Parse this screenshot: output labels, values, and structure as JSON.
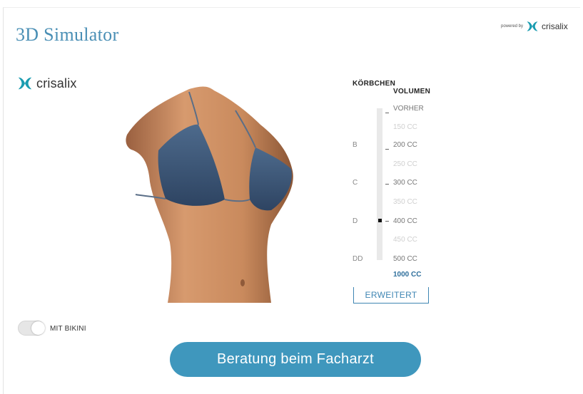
{
  "header": {
    "title": "3D Simulator",
    "powered_by": "powered by",
    "brand": "crisalix"
  },
  "logo": {
    "brand": "crisalix",
    "icon": "crisalix-x-icon"
  },
  "simulator": {
    "cup_header": "KÖRBCHEN",
    "volume_header": "VOLUMEN",
    "cups": [
      "B",
      "C",
      "D",
      "DD"
    ],
    "volumes": [
      "VORHER",
      "150 CC",
      "200 CC",
      "250 CC",
      "300 CC",
      "350 CC",
      "400 CC",
      "450 CC",
      "500 CC"
    ],
    "selected_volume": "1000 CC",
    "expand_button": "ERWEITERT"
  },
  "toggle": {
    "label": "MIT BIKINI",
    "on": false
  },
  "cta": {
    "label": "Beratung beim Facharzt"
  },
  "colors": {
    "accent": "#3f97bd",
    "title": "#4a8fb5",
    "bikini": "#3d5573",
    "skin": "#c8875a"
  }
}
